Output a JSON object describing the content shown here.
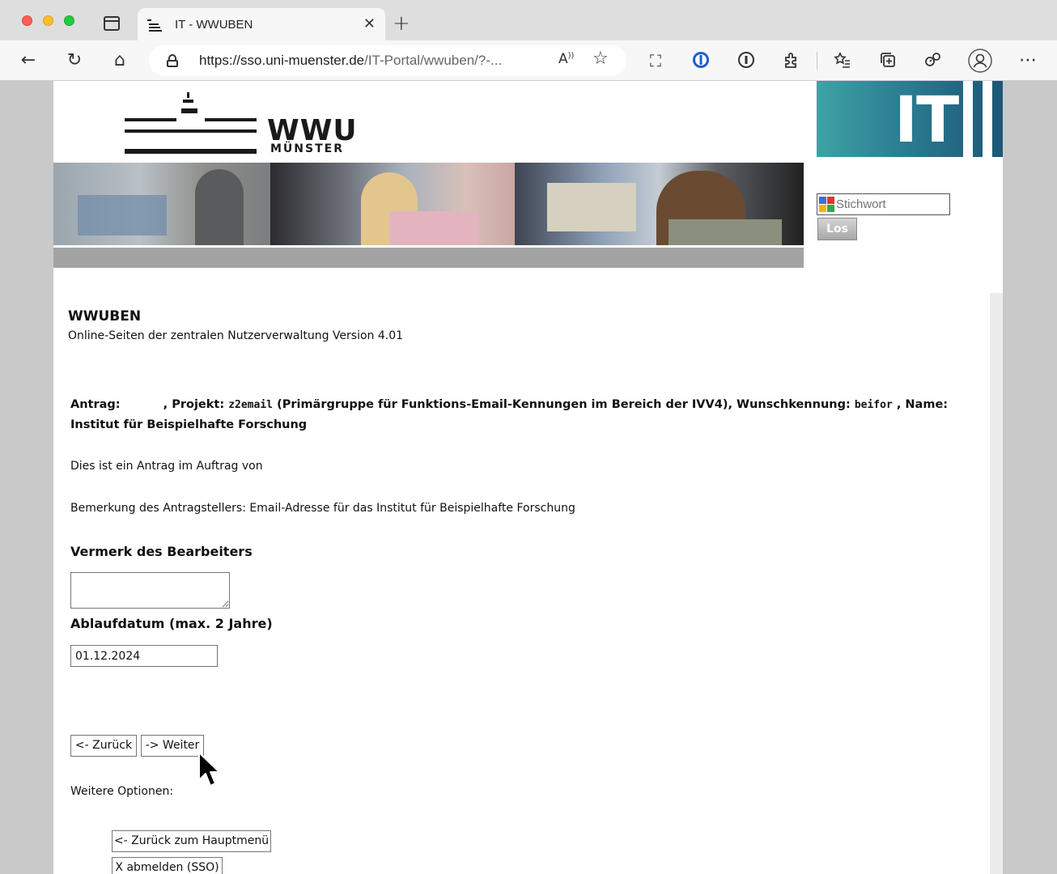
{
  "browser": {
    "tab_title": "IT - WWUBEN",
    "tab_close": "✕",
    "new_tab": "+",
    "url_host": "https://sso.uni-muenster.de",
    "url_path": "/IT-Portal/wwuben/?-...",
    "read_aloud": "Ȃ",
    "nav": {
      "back": "←",
      "reload": "↻",
      "home": "⌂",
      "more": "⋯"
    }
  },
  "header": {
    "logo_main": "WWU",
    "logo_sub": "MÜNSTER",
    "it_logo": "IT",
    "search_placeholder": "Stichwort",
    "search_button": "Los"
  },
  "main": {
    "title": "WWUBEN",
    "subtitle": "Online-Seiten der zentralen Nutzerverwaltung Version 4.01",
    "antrag_label": "Antrag:",
    "projekt_label": ", Projekt:",
    "projekt_value": "z2email",
    "projekt_desc": "(Primärgruppe für Funktions-Email-Kennungen im Bereich der IVV4), Wunschkennung:",
    "wunsch_value": "beifor",
    "name_label": ", Name:",
    "name_value": "Institut für Beispielhafte Forschung",
    "auftrag_text": "Dies ist ein Antrag im Auftrag von",
    "bemerkung_text": "Bemerkung des Antragstellers: Email-Adresse für das Institut für Beispielhafte Forschung",
    "vermerk_heading": "Vermerk des Bearbeiters",
    "vermerk_value": "",
    "ablauf_heading": "Ablaufdatum (max. 2 Jahre)",
    "ablauf_value": "01.12.2024",
    "back_button": "<- Zurück",
    "next_button": "-> Weiter",
    "more_options": "Weitere Optionen:",
    "main_menu_button": "<- Zurück zum Hauptmenü",
    "logout_button": "X abmelden (SSO)"
  },
  "colors": {
    "it_logo_start": "#3ea2a4",
    "it_logo_end": "#1d5775",
    "banner_bar": "#a3a3a3"
  }
}
